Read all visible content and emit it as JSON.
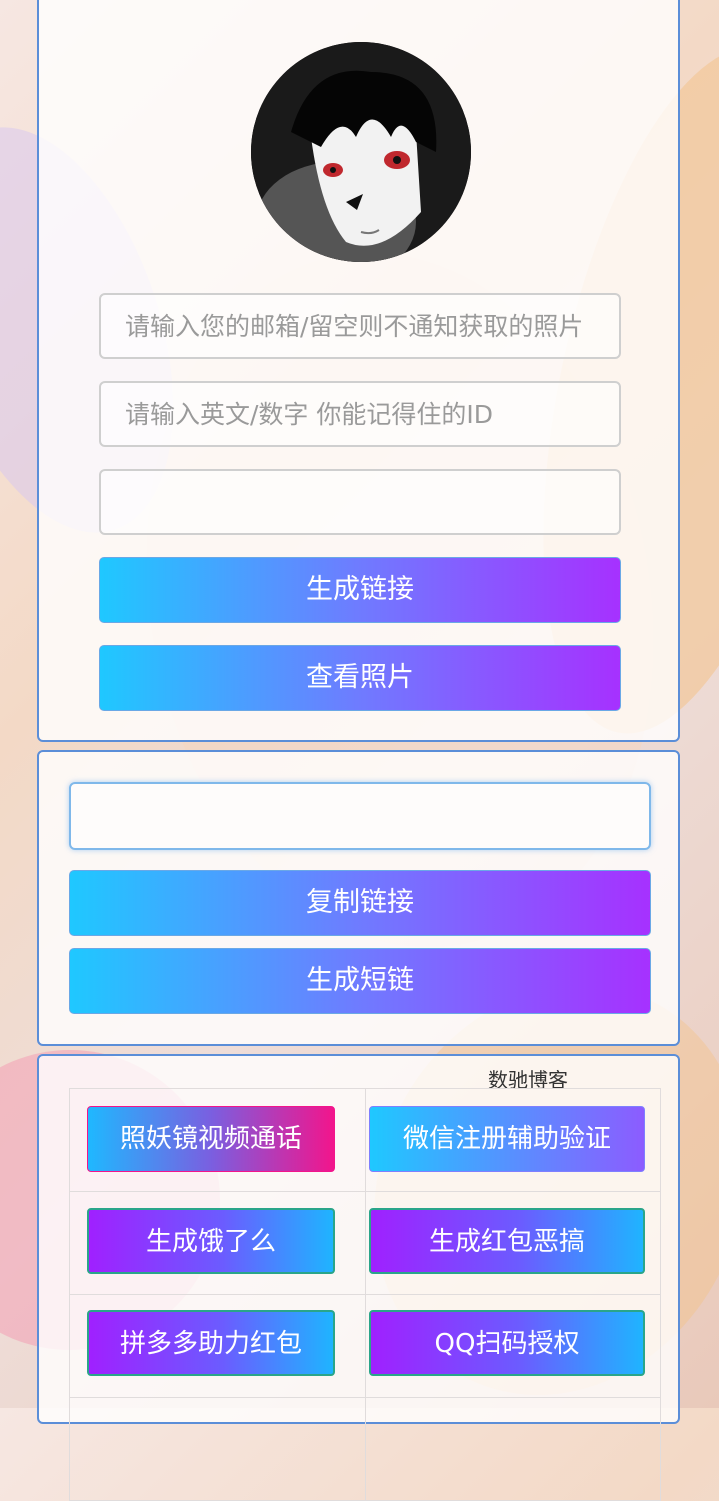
{
  "form": {
    "email_placeholder": "请输入您的邮箱/留空则不通知获取的照片",
    "id_placeholder": "请输入英文/数字 你能记得住的ID",
    "third_value": "",
    "generate_button": "生成链接",
    "view_button": "查看照片"
  },
  "result": {
    "link_value": "",
    "copy_button": "复制链接",
    "short_button": "生成短链"
  },
  "tools": {
    "blog_label": "数驰博客",
    "items": [
      {
        "label": "照妖镜视频通话"
      },
      {
        "label": "微信注册辅助验证"
      },
      {
        "label": "生成饿了么"
      },
      {
        "label": "生成红包恶搞"
      },
      {
        "label": "拼多多助力红包"
      },
      {
        "label": "QQ扫码授权"
      }
    ]
  }
}
